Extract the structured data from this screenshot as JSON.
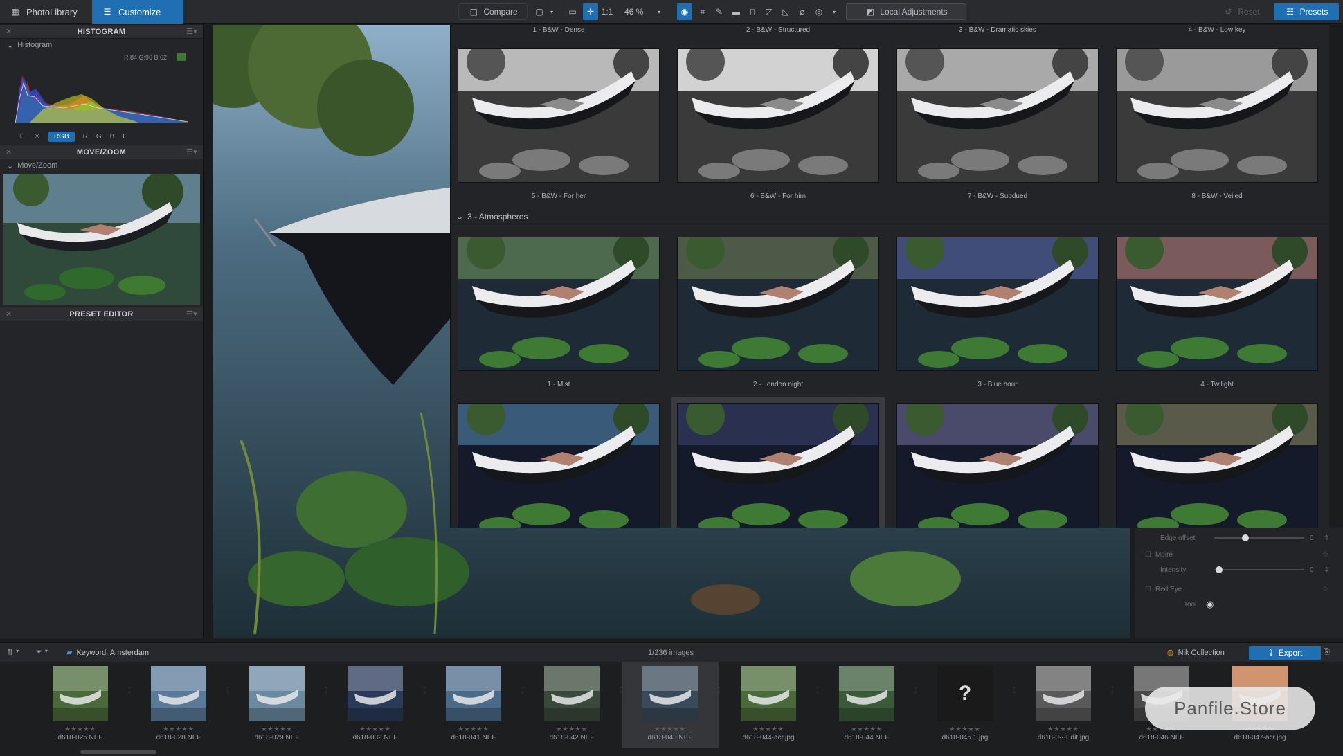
{
  "topbar": {
    "tabs": [
      {
        "label": "PhotoLibrary",
        "icon": "grid-icon"
      },
      {
        "label": "Customize",
        "icon": "sliders-icon"
      }
    ],
    "compare_label": "Compare",
    "zoom_one_to_one": "1:1",
    "zoom_value": "46 %",
    "local_adjustments_label": "Local Adjustments",
    "reset_label": "Reset",
    "presets_label": "Presets"
  },
  "left_panel": {
    "histogram": {
      "title": "HISTOGRAM",
      "subtitle": "Histogram",
      "values": "R:84 G:96 B:62",
      "channels": [
        "RGB",
        "R",
        "G",
        "B",
        "L"
      ]
    },
    "movezoom": {
      "title": "MOVE/ZOOM",
      "subtitle": "Move/Zoom"
    },
    "preset_editor": {
      "title": "PRESET EDITOR"
    }
  },
  "presets": {
    "bw_row_top": [
      "1 - B&W - Dense",
      "2 - B&W - Structured",
      "3 - B&W - Dramatic skies",
      "4 - B&W - Low key"
    ],
    "bw_row": [
      "5 - B&W - For her",
      "6 - B&W - For him",
      "7 - B&W - Subdued",
      "8 - B&W - Veiled"
    ],
    "section_atmospheres": "3 - Atmospheres",
    "atmos_row1": [
      "1 - Mist",
      "2 - London night",
      "3 - Blue hour",
      "4 - Twilight"
    ]
  },
  "right_settings": {
    "edge_offset_label": "Edge offset",
    "edge_offset_value": "0",
    "moire_label": "Moiré",
    "intensity_label": "Intensity",
    "intensity_value": "0",
    "red_eye_label": "Red Eye",
    "red_eye_tool_label": "Tool"
  },
  "strip_bar": {
    "keyword": "Keyword: Amsterdam",
    "count": "1/236 images",
    "nik_label": "Nik Collection",
    "export_label": "Export"
  },
  "filmstrip": [
    {
      "name": "d618-025.NEF",
      "stars": "★★★★★"
    },
    {
      "name": "d618-028.NEF",
      "stars": "★★★★★"
    },
    {
      "name": "d618-029.NEF",
      "stars": "★★★★★"
    },
    {
      "name": "d618-032.NEF",
      "stars": "★★★★★"
    },
    {
      "name": "d618-041.NEF",
      "stars": "★★★★★"
    },
    {
      "name": "d618-042.NEF",
      "stars": "★★★★★"
    },
    {
      "name": "d618-043.NEF",
      "stars": "★★★★★"
    },
    {
      "name": "d618-044-acr.jpg",
      "stars": "★★★★★"
    },
    {
      "name": "d618-044.NEF",
      "stars": "★★★★★"
    },
    {
      "name": "d618-045 1.jpg",
      "stars": "★★★★★"
    },
    {
      "name": "d618-0···Edit.jpg",
      "stars": "★★★★★"
    },
    {
      "name": "d618-046.NEF",
      "stars": "★★★★★"
    },
    {
      "name": "d618-047-acr.jpg",
      "stars": "★★★★★"
    }
  ],
  "watermark": "Panfile.Store"
}
